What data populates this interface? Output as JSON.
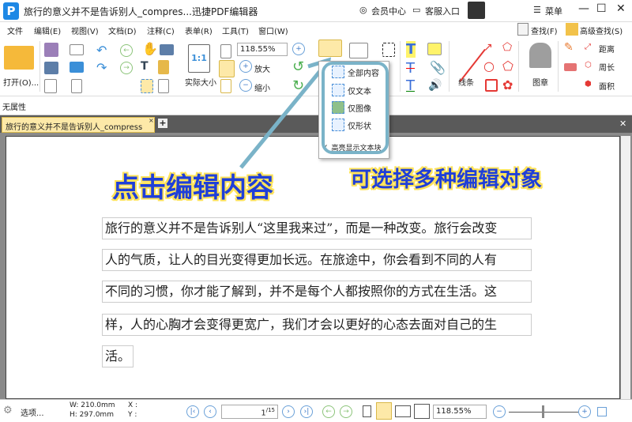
{
  "titlebar": {
    "title": "旅行的意义并不是告诉别人_compres...迅捷PDF编辑器",
    "member": "会员中心",
    "service": "客服入口",
    "menu": "菜单"
  },
  "menubar": [
    "文件",
    "编辑(E)",
    "视图(V)",
    "文档(D)",
    "注释(C)",
    "表单(R)",
    "工具(T)",
    "窗口(W)"
  ],
  "search": {
    "find": "查找(F)",
    "advanced": "高级查找(S)"
  },
  "toolbar": {
    "open": "打开(O)...",
    "actual_size": "实际大小",
    "zoom_value": "118.55%",
    "zoom_in": "放大",
    "zoom_out": "缩小",
    "lines": "线条",
    "stamp": "图章",
    "distance": "距离",
    "perimeter": "周长",
    "area": "面积"
  },
  "dropdown": {
    "items": [
      "全部内容",
      "仅文本",
      "仅图像",
      "仅形状"
    ],
    "highlight": "高亮显示文本块"
  },
  "propbar": {
    "label": "无属性"
  },
  "tab": {
    "label": "旅行的意义并不是告诉别人_compress"
  },
  "document": {
    "lines": [
      "旅行的意义并不是告诉别人“这里我来过”，而是一种改变。旅行会改变",
      "人的气质，让人的目光变得更加长远。在旅途中，你会看到不同的人有",
      "不同的习惯，你才能了解到，并不是每个人都按照你的方式在生活。这",
      "样，人的心胸才会变得更宽广，我们才会以更好的心态去面对自己的生",
      "活。"
    ]
  },
  "annotations": {
    "left": "点击编辑内容",
    "right": "可选择多种编辑对象"
  },
  "status": {
    "options": "选项...",
    "width": "W: 210.0mm",
    "height": "H: 297.0mm",
    "x": "X :",
    "y": "Y :",
    "page_current": "1",
    "page_total": "/15",
    "zoom": "118.55%"
  },
  "colors": {
    "accent": "#1e88e5",
    "annotation_text": "#1f3fd8",
    "annotation_outline": "#ffe35a",
    "arrow": "#7ab3c8"
  }
}
